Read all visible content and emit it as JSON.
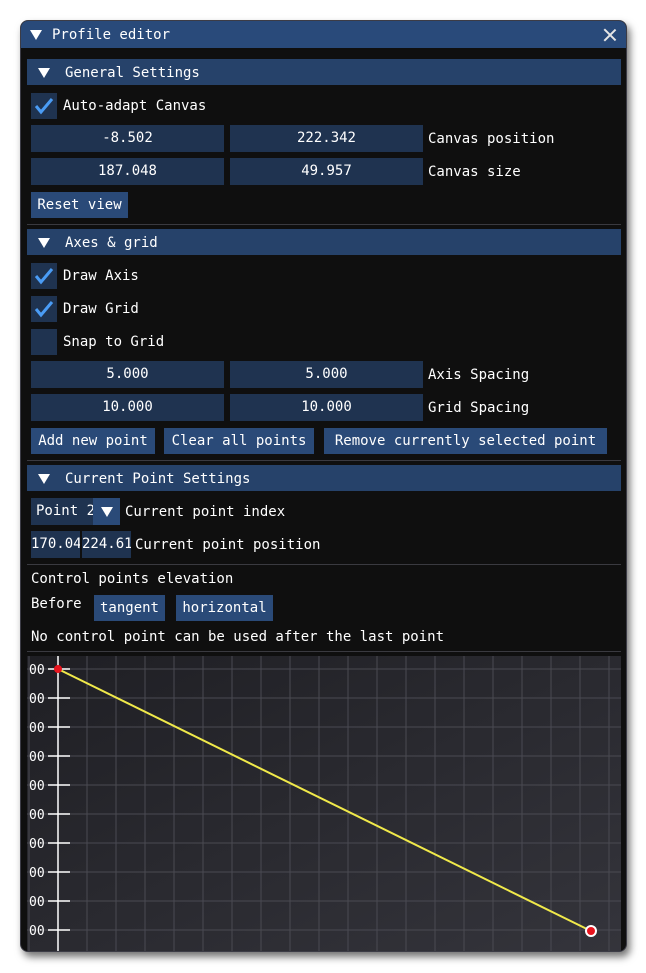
{
  "window": {
    "title": "Profile editor"
  },
  "general": {
    "header": "General Settings",
    "auto_adapt_label": "Auto-adapt Canvas",
    "auto_adapt_checked": true,
    "canvas_position": {
      "x": "-8.502",
      "y": "222.342",
      "label": "Canvas position"
    },
    "canvas_size": {
      "x": "187.048",
      "y": "49.957",
      "label": "Canvas size"
    },
    "reset_view": "Reset view"
  },
  "axes": {
    "header": "Axes & grid",
    "draw_axis_label": "Draw Axis",
    "draw_axis_checked": true,
    "draw_grid_label": "Draw Grid",
    "draw_grid_checked": true,
    "snap_label": "Snap to Grid",
    "snap_checked": false,
    "axis_spacing": {
      "x": "5.000",
      "y": "5.000",
      "label": "Axis Spacing"
    },
    "grid_spacing": {
      "x": "10.000",
      "y": "10.000",
      "label": "Grid Spacing"
    },
    "add_point": "Add new point",
    "clear_points": "Clear all points",
    "remove_point": "Remove currently selected point"
  },
  "current": {
    "header": "Current Point Settings",
    "point_select": "Point 2",
    "point_index_label": "Current point index",
    "pos_x": "170.04",
    "pos_y": "224.61",
    "pos_label": "Current point position",
    "elevation_label": "Control points elevation",
    "before_label": "Before",
    "tangent_btn": "tangent",
    "horizontal_btn": "horizontal",
    "no_after_msg": "No control point can be used after the last point"
  },
  "plot": {
    "tick_label": "00",
    "tick_count": 10,
    "line_color": "#f0e94a",
    "point_color": "#e8141e"
  }
}
